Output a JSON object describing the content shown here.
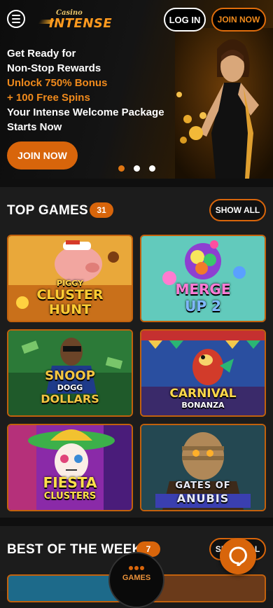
{
  "header": {
    "menu_icon": "hamburger-icon",
    "logo": {
      "small": "Casino",
      "big": "INTENSE"
    },
    "login_label": "LOG IN",
    "join_label": "JOIN NOW"
  },
  "hero": {
    "lines": [
      "Get Ready for",
      "Non-Stop Rewards",
      "Unlock 750% Bonus",
      "+ 100 Free Spins",
      "Your Intense Welcome Package",
      "Starts Now"
    ],
    "join_label": "JOIN NOW",
    "slides": 3,
    "active_slide": 1,
    "colors": {
      "accent": "#d8650b",
      "highlight": "#f08a1c"
    }
  },
  "top_games": {
    "title": "TOP GAMES",
    "count": "31",
    "show_all_label": "SHOW ALL",
    "games": [
      {
        "title_lines": [
          "PIGGY",
          "CLUSTER",
          "HUNT"
        ]
      },
      {
        "title_lines": [
          "MERGE",
          "UP 2"
        ]
      },
      {
        "title_lines": [
          "SNOOP",
          "DOGG",
          "DOLLARS"
        ]
      },
      {
        "title_lines": [
          "CARNIVAL",
          "BONANZA"
        ]
      },
      {
        "title_lines": [
          "FIESTA",
          "CLUSTERS"
        ]
      },
      {
        "title_lines": [
          "GATES OF",
          "ANUBIS"
        ]
      }
    ]
  },
  "best_of_week": {
    "title": "BEST OF THE WEEK",
    "count": "7",
    "show_all_label": "SHOW ALL"
  },
  "bottom_nav": {
    "games_label": "GAMES",
    "games_icon": "dots-icon",
    "chat_icon": "chat-icon"
  }
}
